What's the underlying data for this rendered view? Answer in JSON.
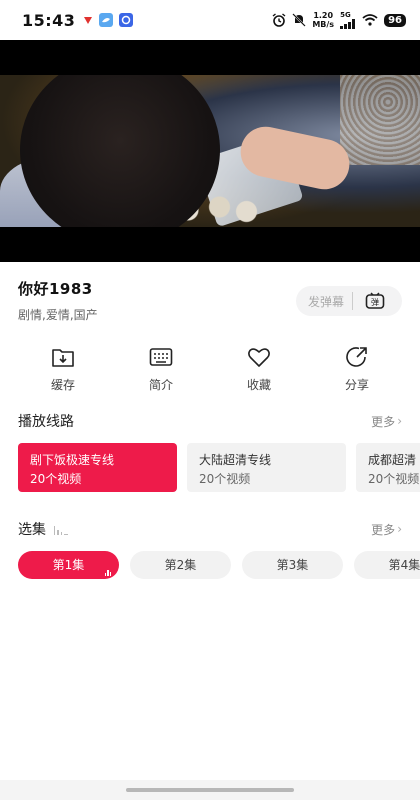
{
  "status": {
    "time": "15:43",
    "net_speed_value": "1.20",
    "net_speed_unit": "MB/s",
    "signal_label": "5G",
    "battery": "96"
  },
  "video": {
    "playing": true
  },
  "show": {
    "title": "你好1983",
    "tags": "剧情,爱情,国产"
  },
  "danmu": {
    "placeholder": "发弹幕",
    "toggle_icon": "danmu-toggle-icon"
  },
  "actions": [
    {
      "label": "缓存",
      "icon": "download-icon"
    },
    {
      "label": "简介",
      "icon": "keyboard-icon"
    },
    {
      "label": "收藏",
      "icon": "heart-icon"
    },
    {
      "label": "分享",
      "icon": "share-icon"
    }
  ],
  "lines_section": {
    "title": "播放线路",
    "more": "更多"
  },
  "lines": [
    {
      "name": "剧下饭极速专线",
      "count": "20个视频",
      "active": true
    },
    {
      "name": "大陆超清专线",
      "count": "20个视频",
      "active": false
    },
    {
      "name": "成都超清",
      "count": "20个视频",
      "active": false
    }
  ],
  "episodes_section": {
    "title": "选集",
    "more": "更多"
  },
  "episodes": [
    {
      "label": "第1集",
      "active": true
    },
    {
      "label": "第2集",
      "active": false
    },
    {
      "label": "第3集",
      "active": false
    },
    {
      "label": "第4集",
      "active": false
    }
  ],
  "colors": {
    "accent": "#ee1b4a",
    "chip_bg": "#f2f2f2",
    "text": "#222222"
  }
}
